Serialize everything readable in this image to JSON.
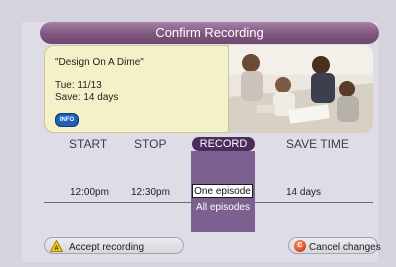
{
  "header": {
    "title": "Confirm Recording"
  },
  "program": {
    "title": "\"Design On A Dime\"",
    "date": "Tue:  11/13",
    "save": "Save: 14 days",
    "info_label": "INFO"
  },
  "columns": {
    "start": "START",
    "stop": "STOP",
    "record": "RECORD",
    "save_time": "SAVE TIME"
  },
  "values": {
    "start": "12:00pm",
    "stop": "12:30pm",
    "save_time": "14 days"
  },
  "record_options": {
    "selected": "One episode",
    "other": "All episodes"
  },
  "footer": {
    "accept_label": "Accept recording",
    "accept_key": "A",
    "cancel_label": "Cancel changes",
    "cancel_key": "C"
  },
  "colors": {
    "accent": "#7f567f",
    "record_column": "#7c6090",
    "info_button": "#1f5fb8",
    "accept_button": "#f2d01a",
    "cancel_button": "#e0552a"
  }
}
